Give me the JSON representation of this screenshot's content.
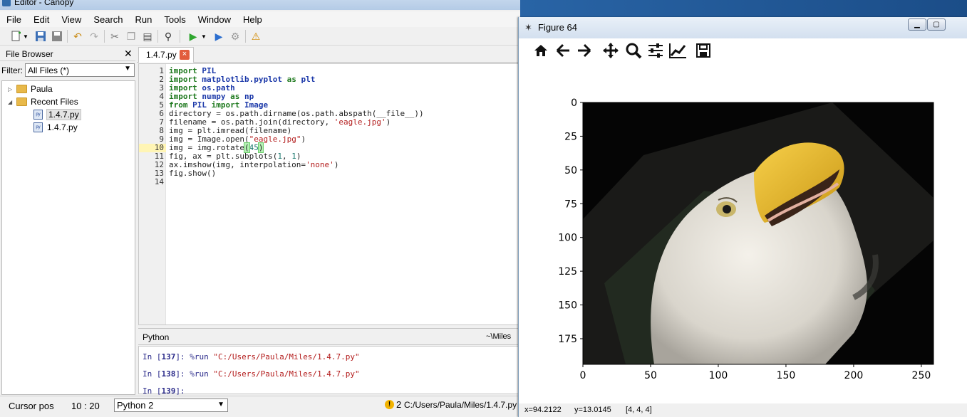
{
  "editor": {
    "title": "Editor - Canopy",
    "menu": [
      "File",
      "Edit",
      "View",
      "Search",
      "Run",
      "Tools",
      "Window",
      "Help"
    ],
    "file_browser": {
      "title": "File Browser",
      "filter_label": "Filter:",
      "filter_value": "All Files (*)",
      "tree": [
        {
          "label": "Paula",
          "type": "folder",
          "expanded": false
        },
        {
          "label": "Recent Files",
          "type": "folder",
          "expanded": true
        },
        {
          "label": "1.4.7.py",
          "type": "file",
          "selected": true
        },
        {
          "label": "1.4.7.py",
          "type": "file",
          "selected": false
        }
      ]
    },
    "tab": {
      "label": "1.4.7.py",
      "close": "×"
    },
    "line_numbers": [
      "1",
      "2",
      "3",
      "4",
      "5",
      "6",
      "7",
      "8",
      "9",
      "10",
      "11",
      "12",
      "13",
      "14"
    ],
    "code_lines": [
      "import PIL",
      "import matplotlib.pyplot as plt",
      "import os.path",
      "import numpy as np",
      "from PIL import Image",
      "directory = os.path.dirname(os.path.abspath(__file__))",
      "filename = os.path.join(directory, 'eagle.jpg')",
      "img = plt.imread(filename)",
      "img = Image.open(\"eagle.jpg\")",
      "img = img.rotate(45)",
      "fig, ax = plt.subplots(1, 1)",
      "ax.imshow(img, interpolation='none')",
      "fig.show()",
      ""
    ],
    "shell": {
      "title": "Python",
      "cwd": "~\\Miles",
      "lines": [
        "In [137]: %run \"C:/Users/Paula/Miles/1.4.7.py\"",
        "In [138]: %run \"C:/Users/Paula/Miles/1.4.7.py\"",
        "In [139]:"
      ]
    },
    "status": {
      "cursor_label": "Cursor pos",
      "cursor_value": "10 : 20",
      "interpreter": "Python 2",
      "warning_count": "2",
      "path": "C:/Users/Paula/Miles/1.4.7.py"
    }
  },
  "figure": {
    "title": "Figure 64",
    "toolbar": [
      "home-icon",
      "back-icon",
      "forward-icon",
      "pan-icon",
      "zoom-icon",
      "configure-subplots-icon",
      "edit-axes-icon",
      "save-icon"
    ],
    "status": {
      "x": "x=94.2122",
      "y": "y=13.0145",
      "pixel": "[4, 4, 4]"
    }
  },
  "chart_data": {
    "type": "image",
    "title": "",
    "xlabel": "",
    "ylabel": "",
    "xlim": [
      0,
      259
    ],
    "ylim": [
      194,
      0
    ],
    "xticks": [
      "0",
      "50",
      "100",
      "150",
      "200",
      "250"
    ],
    "yticks": [
      "0",
      "25",
      "50",
      "75",
      "100",
      "125",
      "150",
      "175"
    ],
    "image_content": "eagle head rotated 45 degrees on black background"
  }
}
